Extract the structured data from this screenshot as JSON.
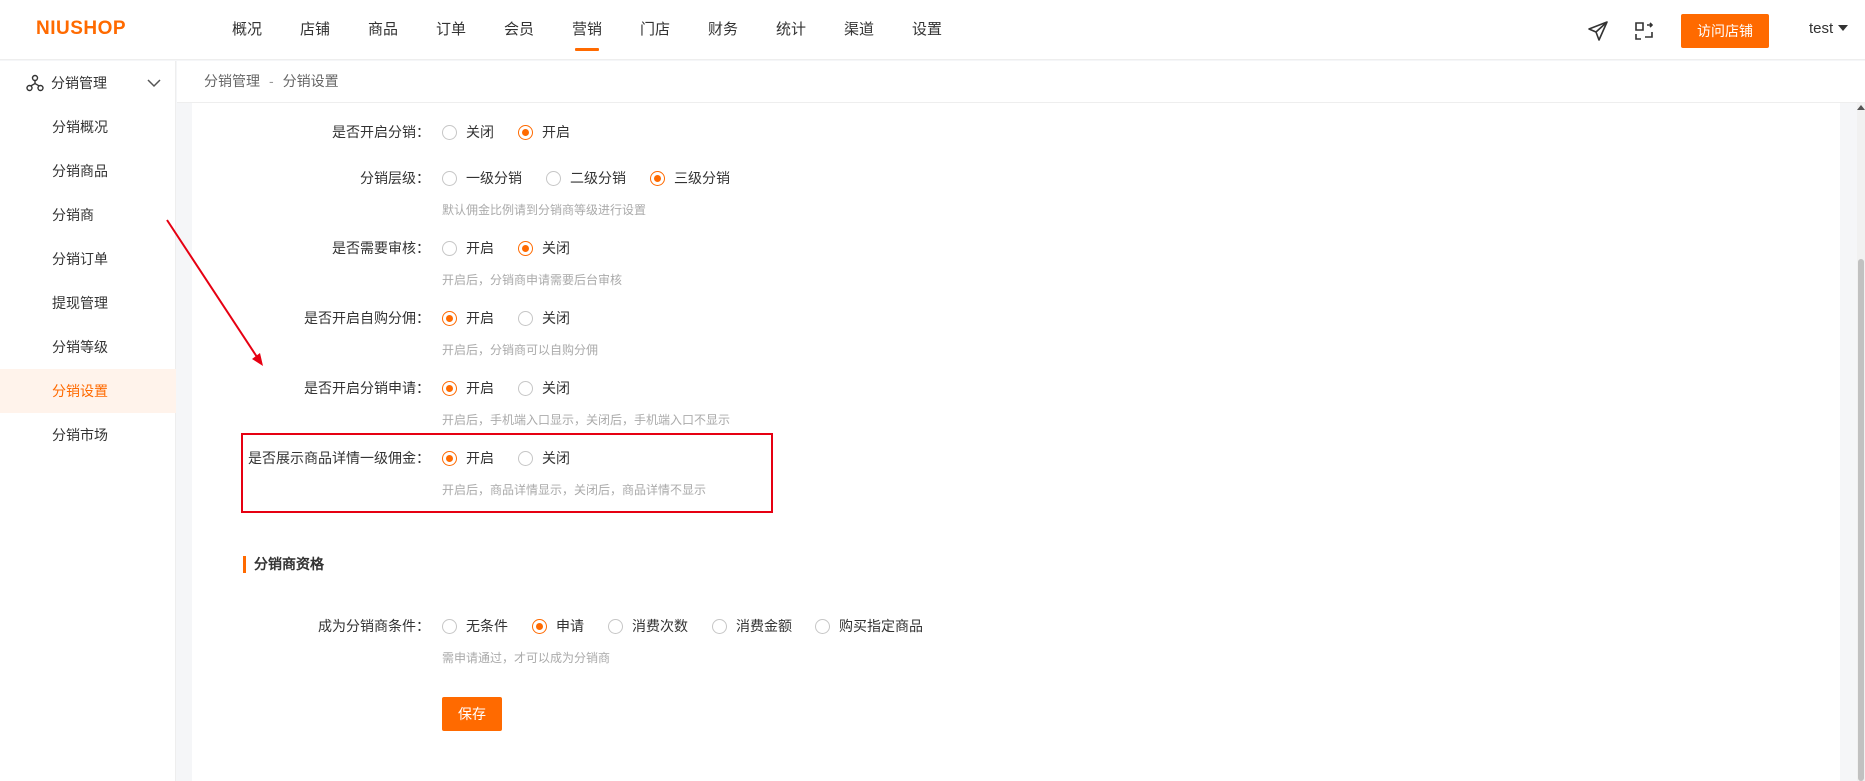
{
  "header": {
    "logo": "NIUSHOP",
    "nav": [
      "概况",
      "店铺",
      "商品",
      "订单",
      "会员",
      "营销",
      "门店",
      "财务",
      "统计",
      "渠道",
      "设置"
    ],
    "active_nav": "营销",
    "visit_store": "访问店铺",
    "user": "test",
    "icons": [
      "paper-plane-icon",
      "switch-icon"
    ]
  },
  "sidebar": {
    "group_label": "分销管理",
    "items": [
      "分销概况",
      "分销商品",
      "分销商",
      "分销订单",
      "提现管理",
      "分销等级",
      "分销设置",
      "分销市场"
    ],
    "active_item": "分销设置"
  },
  "breadcrumb": [
    "分销管理",
    "分销设置"
  ],
  "breadcrumb_sep": "-",
  "form": {
    "enable_distribution": {
      "label": "是否开启分销：",
      "options": [
        "关闭",
        "开启"
      ],
      "selected": "开启"
    },
    "distribution_level": {
      "label": "分销层级：",
      "options": [
        "一级分销",
        "二级分销",
        "三级分销"
      ],
      "selected": "三级分销",
      "hint": "默认佣金比例请到分销商等级进行设置"
    },
    "need_review": {
      "label": "是否需要审核：",
      "options": [
        "开启",
        "关闭"
      ],
      "selected": "关闭",
      "hint": "开启后，分销商申请需要后台审核"
    },
    "self_purchase": {
      "label": "是否开启自购分佣：",
      "options": [
        "开启",
        "关闭"
      ],
      "selected": "开启",
      "hint": "开启后，分销商可以自购分佣"
    },
    "apply_enabled": {
      "label": "是否开启分销申请：",
      "options": [
        "开启",
        "关闭"
      ],
      "selected": "开启",
      "hint": "开启后，手机端入口显示，关闭后，手机端入口不显示"
    },
    "show_commission": {
      "label": "是否展示商品详情一级佣金：",
      "options": [
        "开启",
        "关闭"
      ],
      "selected": "开启",
      "hint": "开启后，商品详情显示，关闭后，商品详情不显示"
    }
  },
  "qualification": {
    "section_title": "分销商资格",
    "condition": {
      "label": "成为分销商条件：",
      "options": [
        "无条件",
        "申请",
        "消费次数",
        "消费金额",
        "购买指定商品"
      ],
      "selected": "申请",
      "hint": "需申请通过，才可以成为分销商"
    }
  },
  "save_label": "保存",
  "colors": {
    "accent": "#ff6a00",
    "annotation": "#e60012"
  }
}
